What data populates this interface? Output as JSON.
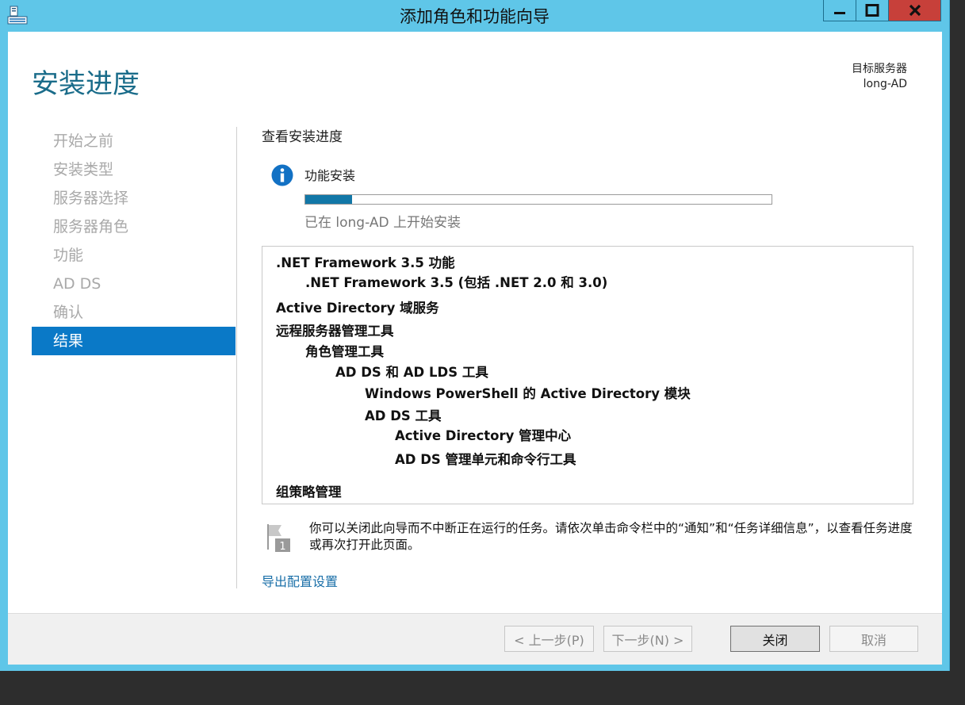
{
  "window": {
    "title": "添加角色和功能向导",
    "controls": [
      "minimize-icon",
      "maximize-icon",
      "close-icon"
    ]
  },
  "header": {
    "heading": "安装进度",
    "target_server_label": "目标服务器",
    "target_server_name": "long-AD"
  },
  "nav": {
    "items": [
      {
        "label": "开始之前",
        "active": false
      },
      {
        "label": "安装类型",
        "active": false
      },
      {
        "label": "服务器选择",
        "active": false
      },
      {
        "label": "服务器角色",
        "active": false
      },
      {
        "label": "功能",
        "active": false
      },
      {
        "label": "AD DS",
        "active": false
      },
      {
        "label": "确认",
        "active": false
      },
      {
        "label": "结果",
        "active": true
      }
    ]
  },
  "main": {
    "section_heading": "查看安装进度",
    "install": {
      "label": "功能安装",
      "progress_fraction": 0.1,
      "status": "已在 long-AD 上开始安装"
    },
    "features": [
      {
        "label": ".NET Framework 3.5 功能",
        "level": 0
      },
      {
        "label": ".NET Framework 3.5 (包括 .NET 2.0 和 3.0)",
        "level": 1
      },
      {
        "label": "Active Directory 域服务",
        "level": 0
      },
      {
        "label": "远程服务器管理工具",
        "level": 0
      },
      {
        "label": "角色管理工具",
        "level": 1
      },
      {
        "label": "AD DS 和 AD LDS 工具",
        "level": 2
      },
      {
        "label": "Windows PowerShell 的 Active Directory 模块",
        "level": 3
      },
      {
        "label": "AD DS 工具",
        "level": 3
      },
      {
        "label": "Active Directory 管理中心",
        "level": 4
      },
      {
        "label": "AD DS 管理单元和命令行工具",
        "level": 4
      },
      {
        "label": "组策略管理",
        "level": 0
      }
    ],
    "notice": "你可以关闭此向导而不中断正在运行的任务。请依次单击命令栏中的“通知”和“任务详细信息”，以查看任务进度或再次打开此页面。",
    "notice_badge": "1",
    "export_link": "导出配置设置"
  },
  "footer": {
    "prev_label": "< 上一步(P)",
    "next_label": "下一步(N) >",
    "close_label": "关闭",
    "cancel_label": "取消"
  },
  "colors": {
    "frame": "#5fc6e8",
    "accent": "#1a6c8a",
    "nav_active": "#0a79c7",
    "progress": "#1277a7",
    "close_button": "#c7403a",
    "link": "#1a6fa8"
  }
}
